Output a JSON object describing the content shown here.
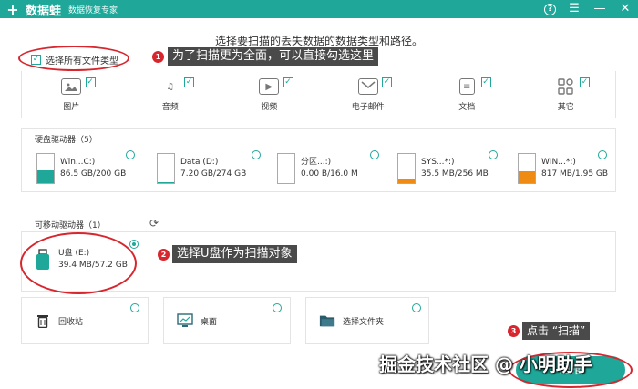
{
  "app": {
    "name": "数据蛙",
    "subtitle": "数据恢复专家",
    "logo": "+"
  },
  "window": {
    "help": "?",
    "minimize": "—",
    "close": "✕",
    "menu": "☰"
  },
  "main_title": "选择要扫描的丢失数据的数据类型和路径。",
  "select_all": {
    "label": "选择所有文件类型",
    "checked": "✓"
  },
  "file_types": [
    {
      "label": "图片",
      "check": "✓"
    },
    {
      "label": "音频",
      "check": "✓"
    },
    {
      "label": "视频",
      "check": "✓"
    },
    {
      "label": "电子邮件",
      "check": "✓"
    },
    {
      "label": "文档",
      "check": "✓"
    },
    {
      "label": "其它",
      "check": "✓"
    }
  ],
  "hard_drives": {
    "title": "硬盘驱动器（5）",
    "items": [
      {
        "name": "Win...C:)",
        "size": "86.5 GB/200 GB",
        "fill_fraction": 0.43,
        "color": "#1fa89a"
      },
      {
        "name": "Data (D:)",
        "size": "7.20 GB/274 GB",
        "fill_fraction": 0.03,
        "color": "#1fa89a"
      },
      {
        "name": "分区...:)",
        "size": "0.00  B/16.0 M",
        "fill_fraction": 0.0,
        "color": "#ef8a12"
      },
      {
        "name": "SYS...*:)",
        "size": "35.5 MB/256 MB",
        "fill_fraction": 0.14,
        "color": "#ef8a12"
      },
      {
        "name": "WIN...*:)",
        "size": "817 MB/1.95 GB",
        "fill_fraction": 0.42,
        "color": "#ef8a12"
      }
    ]
  },
  "removable": {
    "title": "可移动驱动器（1）",
    "items": [
      {
        "name": "U盘 (E:)",
        "size": "39.4 MB/57.2 GB"
      }
    ]
  },
  "locations": [
    {
      "label": "回收站",
      "icon": "trash-icon"
    },
    {
      "label": "桌面",
      "icon": "desktop-icon"
    },
    {
      "label": "选择文件夹",
      "icon": "folder-icon"
    }
  ],
  "annotations": [
    {
      "num": "1",
      "text": "为了扫描更为全面，可以直接勾选这里"
    },
    {
      "num": "2",
      "text": "选择U盘作为扫描对象"
    },
    {
      "num": "3",
      "text": "点击 “扫描”"
    }
  ],
  "scan_button": "扫描",
  "watermark": "掘金技术社区 @ 小明助手",
  "colors": {
    "accent": "#1fa89a",
    "annotation": "#d7262e",
    "warning": "#ef8a12"
  }
}
